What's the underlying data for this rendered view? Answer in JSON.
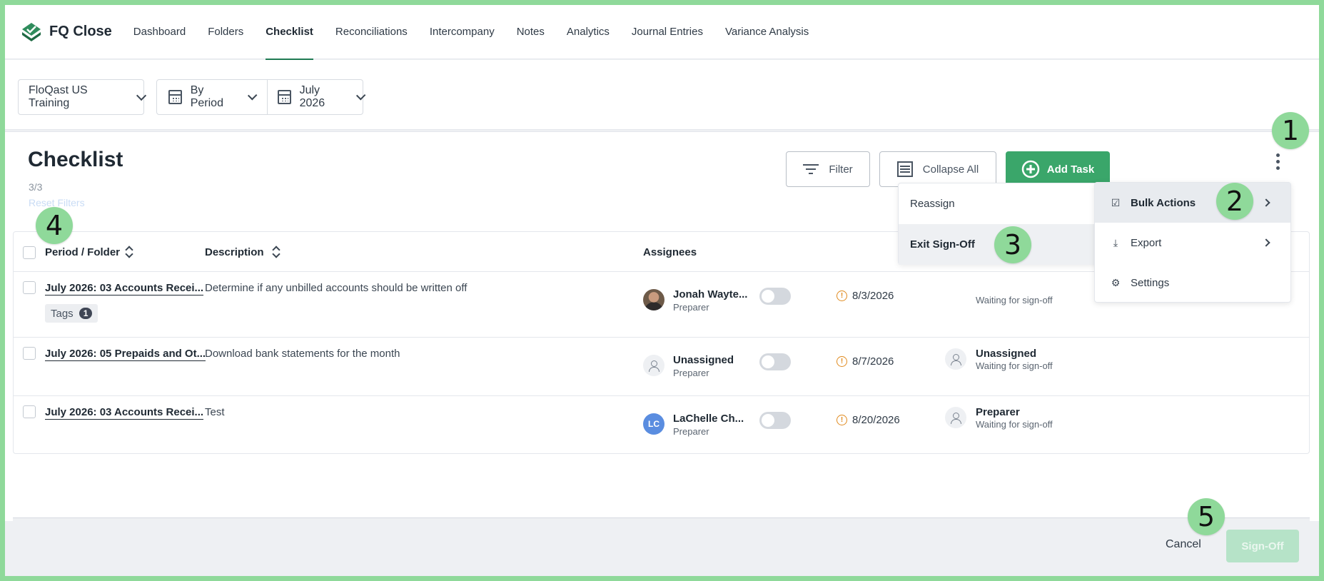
{
  "app": {
    "name": "FQ Close",
    "brand_color": "#3aa66a"
  },
  "nav": {
    "items": [
      "Dashboard",
      "Folders",
      "Checklist",
      "Reconciliations",
      "Intercompany",
      "Notes",
      "Analytics",
      "Journal Entries",
      "Variance Analysis"
    ],
    "active": "Checklist"
  },
  "filters": {
    "entity": "FloQast US Training",
    "view": "By Period",
    "period": "July 2026"
  },
  "checklist": {
    "title": "Checklist",
    "count": "3/3",
    "reset_filters": "Reset Filters",
    "filter_label": "Filter",
    "collapse_label": "Collapse All",
    "add_task_label": "Add Task"
  },
  "table": {
    "headers": {
      "folder": "Period / Folder",
      "description": "Description",
      "assignees": "Assignees"
    },
    "rows": [
      {
        "folder": "July 2026: 03 Accounts Recei...",
        "description": "Determine if any unbilled accounts should be written off",
        "tags_label": "Tags",
        "tags_count": "1",
        "assignee": "Jonah Wayte...",
        "assignee_role": "Preparer",
        "due": "8/3/2026",
        "reviewer": "",
        "reviewer_status": "Waiting for sign-off"
      },
      {
        "folder": "July 2026: 05 Prepaids and Ot...",
        "description": "Download bank statements for the month",
        "assignee": "Unassigned",
        "assignee_role": "Preparer",
        "due": "8/7/2026",
        "reviewer": "Unassigned",
        "reviewer_status": "Waiting for sign-off"
      },
      {
        "folder": "July 2026: 03 Accounts Recei...",
        "description": "Test",
        "assignee": "LaChelle Ch...",
        "assignee_initials": "LC",
        "assignee_role": "Preparer",
        "due": "8/20/2026",
        "reviewer": "Preparer",
        "reviewer_status": "Waiting for sign-off"
      }
    ]
  },
  "menus": {
    "signoff_menu": [
      "Reassign",
      "Exit Sign-Off"
    ],
    "more_menu": [
      "Bulk Actions",
      "Export",
      "Settings"
    ]
  },
  "footer": {
    "cancel": "Cancel",
    "signoff": "Sign-Off"
  },
  "markers": [
    "1",
    "2",
    "3",
    "4",
    "5"
  ]
}
